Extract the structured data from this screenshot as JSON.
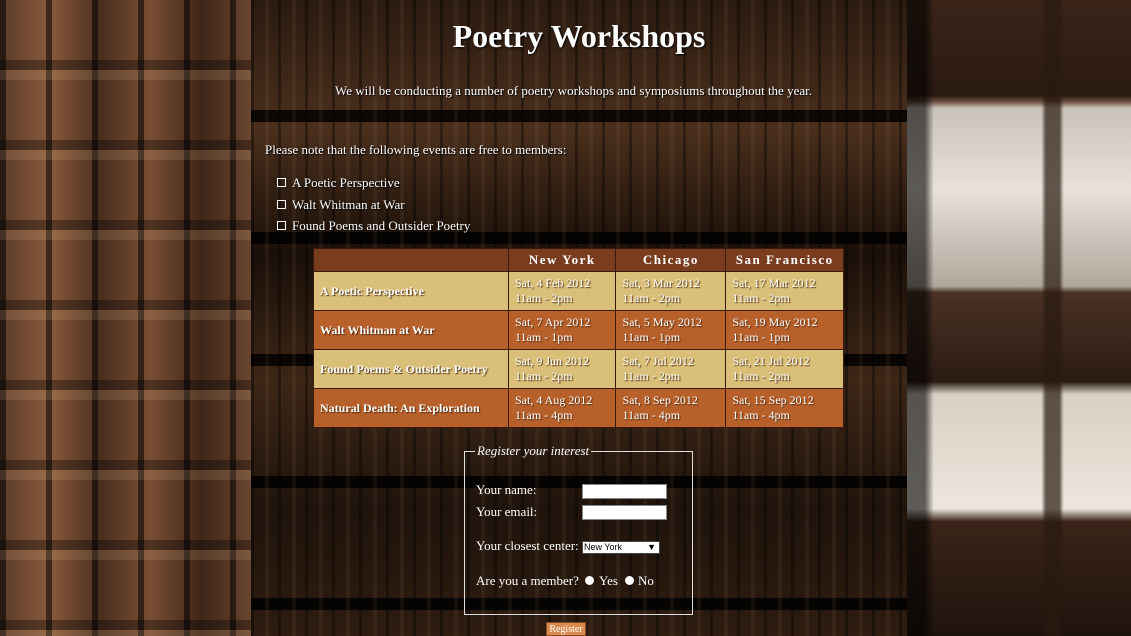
{
  "page": {
    "title": "Poetry Workshops",
    "intro": "We will be conducting a number of poetry workshops and symposiums throughout the year.",
    "note": "Please note that the following events are free to members:"
  },
  "free_events": [
    "A Poetic Perspective",
    "Walt Whitman at War",
    "Found Poems and Outsider Poetry"
  ],
  "schedule": {
    "headers": [
      "",
      "New York",
      "Chicago",
      "San Francisco"
    ],
    "rows": [
      {
        "event": "A Poetic Perspective",
        "cells": [
          {
            "date": "Sat, 4 Feb 2012",
            "time": "11am - 2pm"
          },
          {
            "date": "Sat, 3 Mar 2012",
            "time": "11am - 2pm"
          },
          {
            "date": "Sat, 17 Mar 2012",
            "time": "11am - 2pm"
          }
        ]
      },
      {
        "event": "Walt Whitman at War",
        "cells": [
          {
            "date": "Sat, 7 Apr 2012",
            "time": "11am - 1pm"
          },
          {
            "date": "Sat, 5 May 2012",
            "time": "11am - 1pm"
          },
          {
            "date": "Sat, 19 May 2012",
            "time": "11am - 1pm"
          }
        ]
      },
      {
        "event": "Found Poems & Outsider Poetry",
        "cells": [
          {
            "date": "Sat, 9 Jun 2012",
            "time": "11am - 2pm"
          },
          {
            "date": "Sat, 7 Jul 2012",
            "time": "11am - 2pm"
          },
          {
            "date": "Sat, 21 Jul 2012",
            "time": "11am - 2pm"
          }
        ]
      },
      {
        "event": "Natural Death: An Exploration",
        "cells": [
          {
            "date": "Sat, 4 Aug 2012",
            "time": "11am - 4pm"
          },
          {
            "date": "Sat, 8 Sep 2012",
            "time": "11am - 4pm"
          },
          {
            "date": "Sat, 15 Sep 2012",
            "time": "11am - 4pm"
          }
        ]
      }
    ]
  },
  "form": {
    "legend": "Register your interest",
    "name_label": "Your name:",
    "name_value": "",
    "email_label": "Your email:",
    "email_value": "",
    "center_label": "Your closest center:",
    "center_selected": "New York",
    "member_label": "Are you a member?",
    "yes_label": "Yes",
    "no_label": "No",
    "submit_label": "Register"
  },
  "colors": {
    "header_row": "#7a3c1e",
    "row_light": "#d9bf78",
    "row_dark": "#b8602a"
  }
}
